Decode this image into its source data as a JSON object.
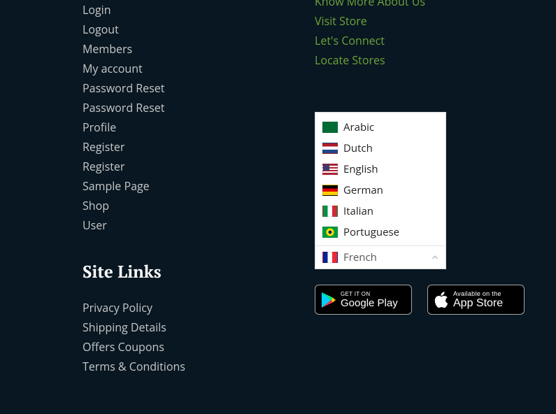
{
  "account_links": [
    {
      "label": "Login"
    },
    {
      "label": "Logout"
    },
    {
      "label": "Members"
    },
    {
      "label": "My account"
    },
    {
      "label": "Password Reset"
    },
    {
      "label": "Password Reset"
    },
    {
      "label": "Profile"
    },
    {
      "label": "Register"
    },
    {
      "label": "Register"
    },
    {
      "label": "Sample Page"
    },
    {
      "label": "Shop"
    },
    {
      "label": "User"
    }
  ],
  "site_links_heading": "Site Links",
  "site_links": [
    {
      "label": "Privacy Policy"
    },
    {
      "label": "Shipping Details"
    },
    {
      "label": "Offers Coupons"
    },
    {
      "label": "Terms & Conditions"
    }
  ],
  "info_links": [
    {
      "label": "Know More About Us"
    },
    {
      "label": "Visit Store"
    },
    {
      "label": "Let's Connect"
    },
    {
      "label": "Locate Stores"
    }
  ],
  "languages": {
    "options": [
      {
        "code": "ar",
        "label": "Arabic",
        "flag": "sa"
      },
      {
        "code": "nl",
        "label": "Dutch",
        "flag": "nl"
      },
      {
        "code": "en",
        "label": "English",
        "flag": "us"
      },
      {
        "code": "de",
        "label": "German",
        "flag": "de"
      },
      {
        "code": "it",
        "label": "Italian",
        "flag": "it"
      },
      {
        "code": "pt",
        "label": "Portuguese",
        "flag": "br"
      }
    ],
    "selected": {
      "code": "fr",
      "label": "French",
      "flag": "fr"
    }
  },
  "store_badges": {
    "google": {
      "top": "GET IT ON",
      "bottom": "Google Play"
    },
    "apple": {
      "top": "Available on the",
      "bottom": "App Store"
    }
  }
}
